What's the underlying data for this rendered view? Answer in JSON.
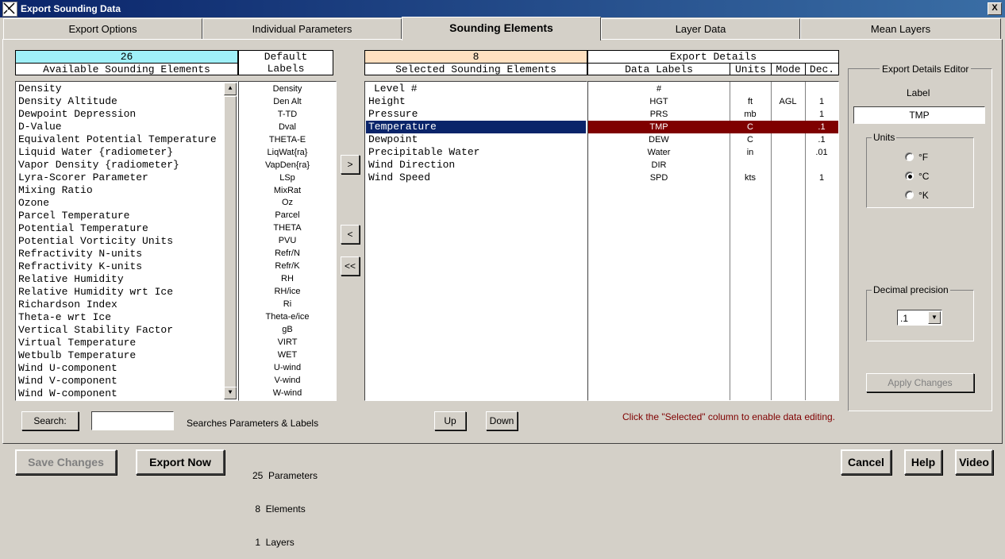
{
  "window": {
    "title": "Export Sounding Data",
    "close": "X"
  },
  "tabs": [
    "Export Options",
    "Individual Parameters",
    "Sounding Elements",
    "Layer Data",
    "Mean Layers"
  ],
  "available": {
    "count": "26",
    "header": "Available Sounding Elements",
    "default_labels_header1": "Default",
    "default_labels_header2": "Labels",
    "items": [
      "Density",
      "Density Altitude",
      "Dewpoint Depression",
      "D-Value",
      "Equivalent Potential Temperature",
      "Liquid Water {radiometer}",
      "Vapor Density {radiometer}",
      "Lyra-Scorer Parameter",
      "Mixing Ratio",
      "Ozone",
      "Parcel Temperature",
      "Potential Temperature",
      "Potential Vorticity Units",
      "Refractivity N-units",
      "Refractivity K-units",
      "Relative Humidity",
      "Relative Humidity wrt Ice",
      "Richardson Index",
      "Theta-e wrt Ice",
      "Vertical Stability Factor",
      "Virtual Temperature",
      "Wetbulb Temperature",
      "Wind U-component",
      "Wind V-component",
      "Wind W-component"
    ],
    "labels": [
      "Density",
      "Den Alt",
      "T-TD",
      "Dval",
      "THETA-E",
      "LiqWat{ra}",
      "VapDen{ra}",
      "LSp",
      "MixRat",
      "Oz",
      "Parcel",
      "THETA",
      "PVU",
      "Refr/N",
      "Refr/K",
      "RH",
      "RH/ice",
      "Ri",
      "Theta-e/ice",
      "gB",
      "VIRT",
      "WET",
      "U-wind",
      "V-wind",
      "W-wind"
    ]
  },
  "buttons": {
    "add": ">",
    "remove": "<",
    "remove_all": "<<",
    "search": "Search:",
    "up": "Up",
    "down": "Down"
  },
  "search": {
    "value": "",
    "hint": "Searches Parameters & Labels"
  },
  "selected": {
    "count": "8",
    "header": "Selected Sounding Elements",
    "details_header": "Export Details",
    "col_labels": "Data Labels",
    "col_units": "Units",
    "col_mode": "Mode",
    "col_dec": "Dec.",
    "rows": [
      {
        "name": "Level #",
        "label": "#",
        "units": "",
        "mode": "",
        "dec": ""
      },
      {
        "name": "Height",
        "label": "HGT",
        "units": "ft",
        "mode": "AGL",
        "dec": "1"
      },
      {
        "name": "Pressure",
        "label": "PRS",
        "units": "mb",
        "mode": "",
        "dec": "1"
      },
      {
        "name": "Temperature",
        "label": "TMP",
        "units": "C",
        "mode": "",
        "dec": ".1"
      },
      {
        "name": "Dewpoint",
        "label": "DEW",
        "units": "C",
        "mode": "",
        "dec": ".1"
      },
      {
        "name": "Precipitable Water",
        "label": "Water",
        "units": "in",
        "mode": "",
        "dec": ".01"
      },
      {
        "name": "Wind Direction",
        "label": "DIR",
        "units": "",
        "mode": "",
        "dec": ""
      },
      {
        "name": "Wind Speed",
        "label": "SPD",
        "units": "kts",
        "mode": "",
        "dec": "1"
      }
    ],
    "hint": "Click the \"Selected\" column to enable data editing."
  },
  "editor": {
    "title": "Export Details Editor",
    "label_caption": "Label",
    "label_value": "TMP",
    "units_caption": "Units",
    "unit_options": [
      "°F",
      "°C",
      "°K"
    ],
    "selected_unit": "°C",
    "precision_caption": "Decimal precision",
    "precision_value": ".1",
    "apply": "Apply Changes"
  },
  "footer": {
    "save": "Save Changes",
    "export": "Export Now",
    "stats": [
      "25  Parameters",
      " 8  Elements",
      " 1  Layers"
    ],
    "cancel": "Cancel",
    "help": "Help",
    "video": "Video"
  },
  "colors": {
    "available_count_bg": "#9ff0f8",
    "selected_count_bg": "#ffe0c0",
    "highlight": "#7f0000",
    "row_select": "#0a246a"
  }
}
